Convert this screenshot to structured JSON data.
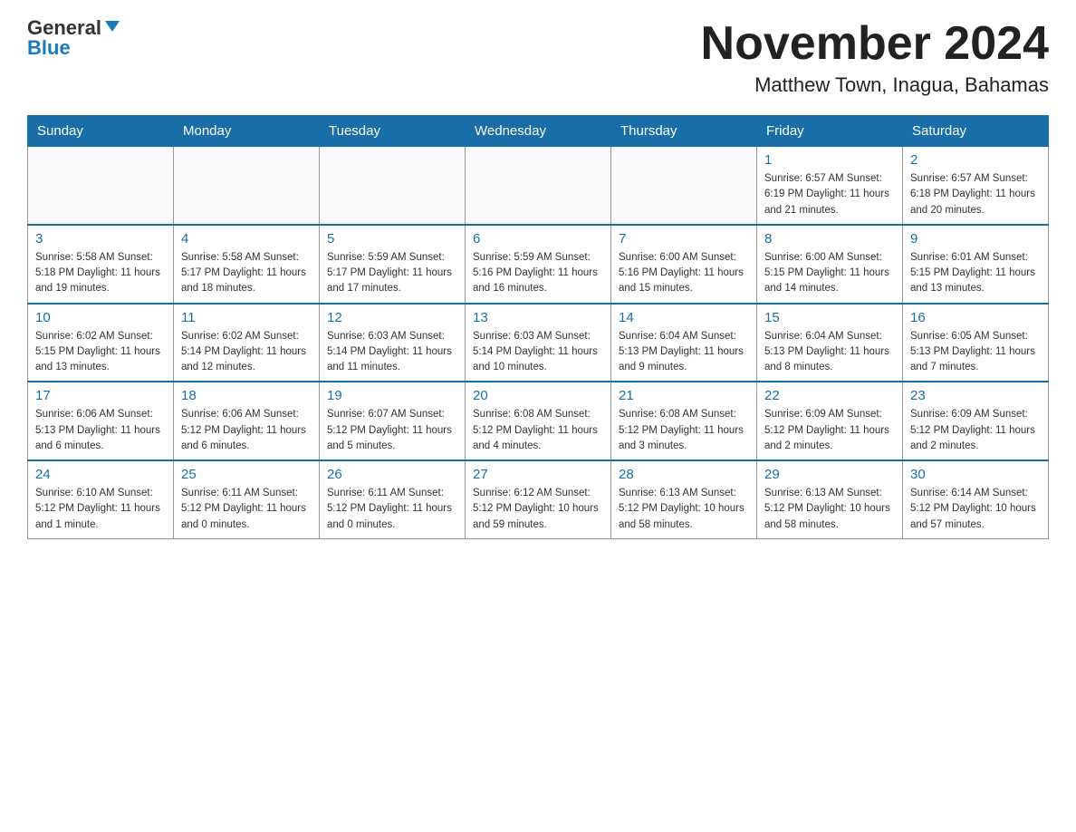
{
  "logo": {
    "general": "General",
    "blue": "Blue"
  },
  "title": "November 2024",
  "subtitle": "Matthew Town, Inagua, Bahamas",
  "weekdays": [
    "Sunday",
    "Monday",
    "Tuesday",
    "Wednesday",
    "Thursday",
    "Friday",
    "Saturday"
  ],
  "weeks": [
    [
      {
        "day": "",
        "info": ""
      },
      {
        "day": "",
        "info": ""
      },
      {
        "day": "",
        "info": ""
      },
      {
        "day": "",
        "info": ""
      },
      {
        "day": "",
        "info": ""
      },
      {
        "day": "1",
        "info": "Sunrise: 6:57 AM\nSunset: 6:19 PM\nDaylight: 11 hours\nand 21 minutes."
      },
      {
        "day": "2",
        "info": "Sunrise: 6:57 AM\nSunset: 6:18 PM\nDaylight: 11 hours\nand 20 minutes."
      }
    ],
    [
      {
        "day": "3",
        "info": "Sunrise: 5:58 AM\nSunset: 5:18 PM\nDaylight: 11 hours\nand 19 minutes."
      },
      {
        "day": "4",
        "info": "Sunrise: 5:58 AM\nSunset: 5:17 PM\nDaylight: 11 hours\nand 18 minutes."
      },
      {
        "day": "5",
        "info": "Sunrise: 5:59 AM\nSunset: 5:17 PM\nDaylight: 11 hours\nand 17 minutes."
      },
      {
        "day": "6",
        "info": "Sunrise: 5:59 AM\nSunset: 5:16 PM\nDaylight: 11 hours\nand 16 minutes."
      },
      {
        "day": "7",
        "info": "Sunrise: 6:00 AM\nSunset: 5:16 PM\nDaylight: 11 hours\nand 15 minutes."
      },
      {
        "day": "8",
        "info": "Sunrise: 6:00 AM\nSunset: 5:15 PM\nDaylight: 11 hours\nand 14 minutes."
      },
      {
        "day": "9",
        "info": "Sunrise: 6:01 AM\nSunset: 5:15 PM\nDaylight: 11 hours\nand 13 minutes."
      }
    ],
    [
      {
        "day": "10",
        "info": "Sunrise: 6:02 AM\nSunset: 5:15 PM\nDaylight: 11 hours\nand 13 minutes."
      },
      {
        "day": "11",
        "info": "Sunrise: 6:02 AM\nSunset: 5:14 PM\nDaylight: 11 hours\nand 12 minutes."
      },
      {
        "day": "12",
        "info": "Sunrise: 6:03 AM\nSunset: 5:14 PM\nDaylight: 11 hours\nand 11 minutes."
      },
      {
        "day": "13",
        "info": "Sunrise: 6:03 AM\nSunset: 5:14 PM\nDaylight: 11 hours\nand 10 minutes."
      },
      {
        "day": "14",
        "info": "Sunrise: 6:04 AM\nSunset: 5:13 PM\nDaylight: 11 hours\nand 9 minutes."
      },
      {
        "day": "15",
        "info": "Sunrise: 6:04 AM\nSunset: 5:13 PM\nDaylight: 11 hours\nand 8 minutes."
      },
      {
        "day": "16",
        "info": "Sunrise: 6:05 AM\nSunset: 5:13 PM\nDaylight: 11 hours\nand 7 minutes."
      }
    ],
    [
      {
        "day": "17",
        "info": "Sunrise: 6:06 AM\nSunset: 5:13 PM\nDaylight: 11 hours\nand 6 minutes."
      },
      {
        "day": "18",
        "info": "Sunrise: 6:06 AM\nSunset: 5:12 PM\nDaylight: 11 hours\nand 6 minutes."
      },
      {
        "day": "19",
        "info": "Sunrise: 6:07 AM\nSunset: 5:12 PM\nDaylight: 11 hours\nand 5 minutes."
      },
      {
        "day": "20",
        "info": "Sunrise: 6:08 AM\nSunset: 5:12 PM\nDaylight: 11 hours\nand 4 minutes."
      },
      {
        "day": "21",
        "info": "Sunrise: 6:08 AM\nSunset: 5:12 PM\nDaylight: 11 hours\nand 3 minutes."
      },
      {
        "day": "22",
        "info": "Sunrise: 6:09 AM\nSunset: 5:12 PM\nDaylight: 11 hours\nand 2 minutes."
      },
      {
        "day": "23",
        "info": "Sunrise: 6:09 AM\nSunset: 5:12 PM\nDaylight: 11 hours\nand 2 minutes."
      }
    ],
    [
      {
        "day": "24",
        "info": "Sunrise: 6:10 AM\nSunset: 5:12 PM\nDaylight: 11 hours\nand 1 minute."
      },
      {
        "day": "25",
        "info": "Sunrise: 6:11 AM\nSunset: 5:12 PM\nDaylight: 11 hours\nand 0 minutes."
      },
      {
        "day": "26",
        "info": "Sunrise: 6:11 AM\nSunset: 5:12 PM\nDaylight: 11 hours\nand 0 minutes."
      },
      {
        "day": "27",
        "info": "Sunrise: 6:12 AM\nSunset: 5:12 PM\nDaylight: 10 hours\nand 59 minutes."
      },
      {
        "day": "28",
        "info": "Sunrise: 6:13 AM\nSunset: 5:12 PM\nDaylight: 10 hours\nand 58 minutes."
      },
      {
        "day": "29",
        "info": "Sunrise: 6:13 AM\nSunset: 5:12 PM\nDaylight: 10 hours\nand 58 minutes."
      },
      {
        "day": "30",
        "info": "Sunrise: 6:14 AM\nSunset: 5:12 PM\nDaylight: 10 hours\nand 57 minutes."
      }
    ]
  ]
}
